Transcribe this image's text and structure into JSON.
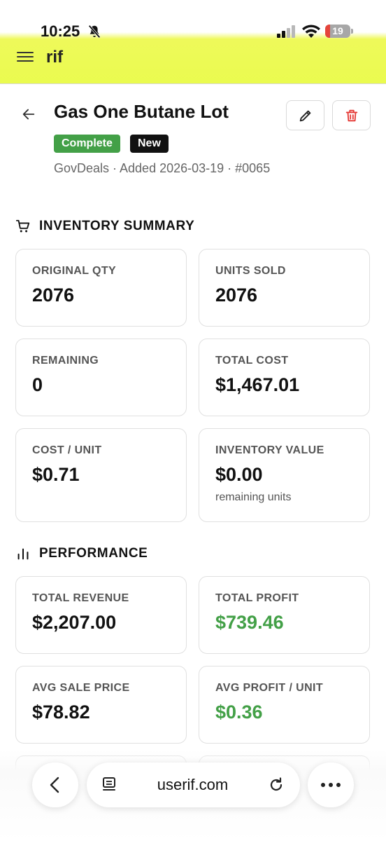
{
  "status_bar": {
    "time": "10:25",
    "battery": "19",
    "battery_level": 0.19
  },
  "header": {
    "brand": "rif",
    "brand_color": "#eafb4f"
  },
  "item": {
    "title": "Gas One Butane Lot",
    "badges": {
      "status": "Complete",
      "tag": "New"
    },
    "meta": "GovDeals · Added 2026-03-19 · #0065"
  },
  "inventory": {
    "heading": "INVENTORY SUMMARY",
    "cards": [
      {
        "label": "ORIGINAL QTY",
        "value": "2076"
      },
      {
        "label": "UNITS SOLD",
        "value": "2076"
      },
      {
        "label": "REMAINING",
        "value": "0"
      },
      {
        "label": "TOTAL COST",
        "value": "$1,467.01"
      },
      {
        "label": "COST / UNIT",
        "value": "$0.71"
      },
      {
        "label": "INVENTORY VALUE",
        "value": "$0.00",
        "note": "remaining units"
      }
    ]
  },
  "performance": {
    "heading": "PERFORMANCE",
    "cards": [
      {
        "label": "TOTAL REVENUE",
        "value": "$2,207.00"
      },
      {
        "label": "TOTAL PROFIT",
        "value": "$739.46"
      },
      {
        "label": "AVG SALE PRICE",
        "value": "$78.82"
      },
      {
        "label": "AVG PROFIT / UNIT",
        "value": "$0.36"
      }
    ]
  },
  "browser": {
    "url": "userif.com"
  },
  "colors": {
    "complete": "#43a047",
    "new": "#111111",
    "profit": "#43a047",
    "delete": "#e53935"
  },
  "icons": [
    "menu-icon",
    "bell-slash-icon",
    "signal-icon",
    "wifi-icon",
    "battery-icon",
    "back-arrow-icon",
    "pencil-icon",
    "trash-icon",
    "cart-icon",
    "bar-chart-icon",
    "chevron-left-icon",
    "reader-icon",
    "reload-icon",
    "more-icon"
  ]
}
